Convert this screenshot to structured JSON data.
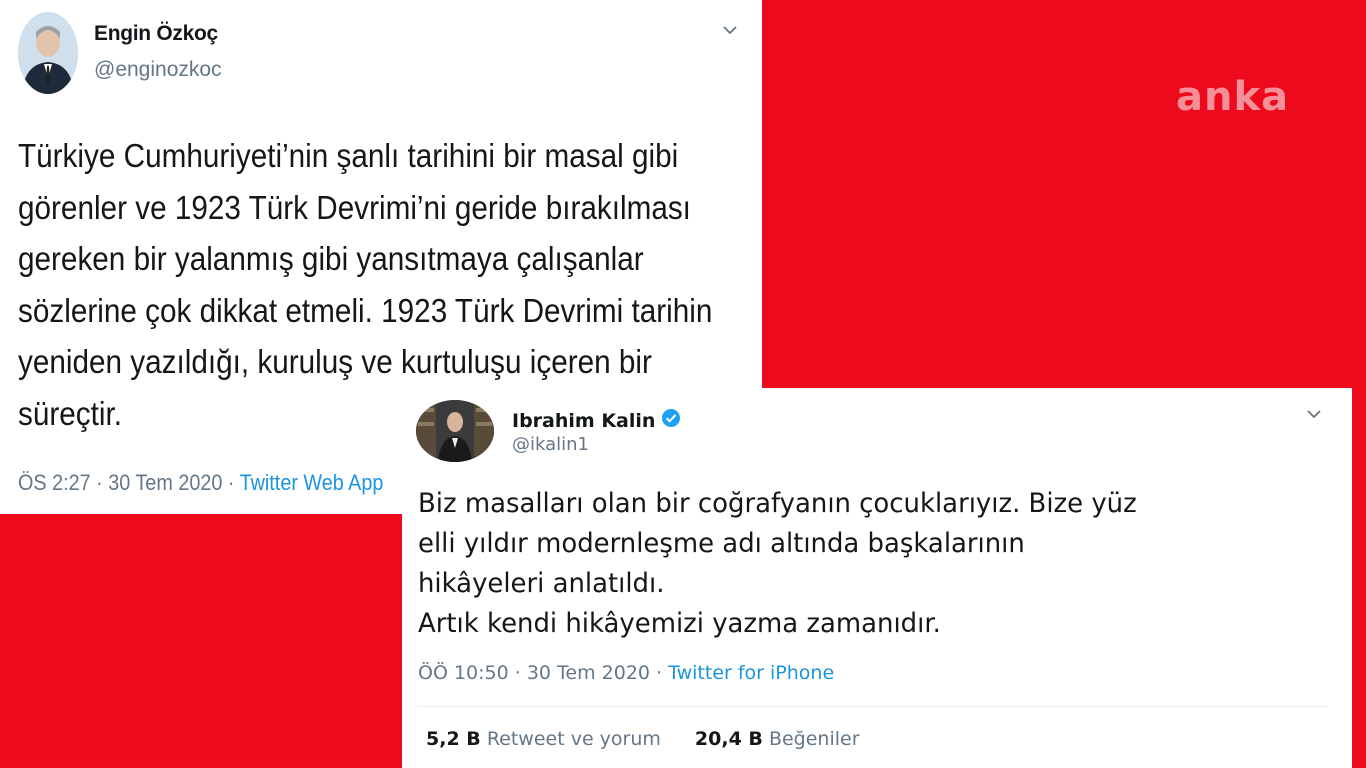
{
  "watermark": "anka",
  "colors": {
    "background": "#ec0a1c",
    "link": "#1b95e0",
    "verified": "#1da1f2"
  },
  "tweet1": {
    "name": "Engin Özkoç",
    "handle": "@enginozkoc",
    "icons": {
      "avatar": "profile-photo",
      "menu": "chevron-down-icon"
    },
    "lines": [
      "Türkiye Cumhuriyeti’nin şanlı tarihini bir masal gibi",
      "görenler ve 1923 Türk Devrimi’ni geride bırakılması",
      "gereken bir yalanmış gibi yansıtmaya çalışanlar",
      "sözlerine çok dikkat etmeli. 1923 Türk Devrimi tarihin",
      "yeniden yazıldığı, kuruluş ve kurtuluşu içeren bir",
      "süreçtir."
    ],
    "time": "ÖS 2:27 · 30 Tem 2020 · ",
    "source": "Twitter Web App"
  },
  "tweet2": {
    "name": "Ibrahim Kalin",
    "handle": "@ikalin1",
    "icons": {
      "avatar": "profile-photo",
      "verified": "verified-badge-icon",
      "menu": "chevron-down-icon"
    },
    "lines": [
      "Biz masalları olan bir coğrafyanın çocuklarıyız. Bize yüz",
      "elli yıldır modernleşme adı altında başkalarının",
      "hikâyeleri anlatıldı.",
      "Artık kendi hikâyemizi yazma zamanıdır."
    ],
    "time": "ÖÖ 10:50 · 30 Tem 2020 · ",
    "source": "Twitter for iPhone",
    "retweets_count": "5,2 B",
    "retweets_label": "Retweet ve yorum",
    "likes_count": "20,4 B",
    "likes_label": "Beğeniler"
  }
}
